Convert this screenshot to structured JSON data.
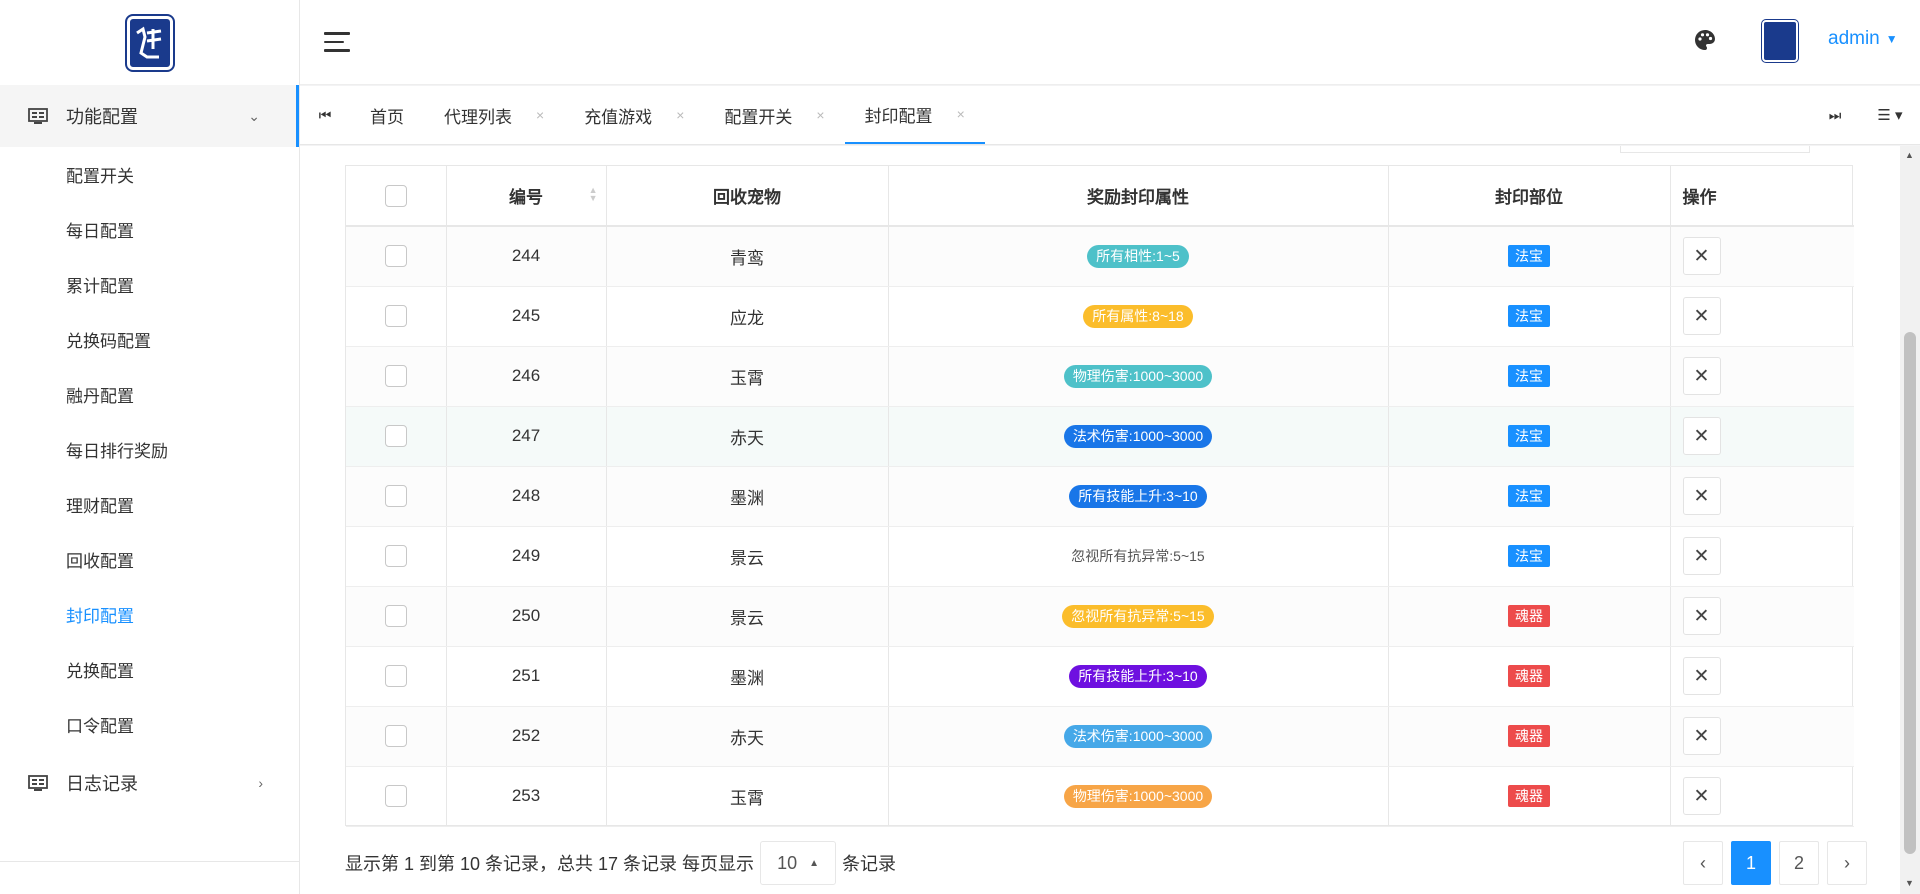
{
  "sidebar": {
    "group1_label": "功能配置",
    "items": [
      "配置开关",
      "每日配置",
      "累计配置",
      "兑换码配置",
      "融丹配置",
      "每日排行奖励",
      "理财配置",
      "回收配置",
      "封印配置",
      "兑换配置",
      "口令配置"
    ],
    "current_item": "封印配置",
    "group2_label": "日志记录"
  },
  "header": {
    "user": "admin"
  },
  "tabs": [
    {
      "label": "首页",
      "closable": false
    },
    {
      "label": "代理列表",
      "closable": true
    },
    {
      "label": "充值游戏",
      "closable": true
    },
    {
      "label": "配置开关",
      "closable": true
    },
    {
      "label": "封印配置",
      "closable": true,
      "active": true
    }
  ],
  "table": {
    "columns": [
      "编号",
      "回收宠物",
      "奖励封印属性",
      "封印部位",
      "操作"
    ],
    "rows": [
      {
        "id": "244",
        "pet": "青鸾",
        "attr": "所有相性:1~5",
        "attr_color": "#4ec1c9",
        "part": "法宝",
        "part_color": "#1890ff"
      },
      {
        "id": "245",
        "pet": "应龙",
        "attr": "所有属性:8~18",
        "attr_color": "#fbbd2b",
        "part": "法宝",
        "part_color": "#1890ff"
      },
      {
        "id": "246",
        "pet": "玉霄",
        "attr": "物理伤害:1000~3000",
        "attr_color": "#4ec1c9",
        "part": "法宝",
        "part_color": "#1890ff"
      },
      {
        "id": "247",
        "pet": "赤天",
        "attr": "法术伤害:1000~3000",
        "attr_color": "#1976e8",
        "part": "法宝",
        "part_color": "#1890ff"
      },
      {
        "id": "248",
        "pet": "墨渊",
        "attr": "所有技能上升:3~10",
        "attr_color": "#1976e8",
        "part": "法宝",
        "part_color": "#1890ff"
      },
      {
        "id": "249",
        "pet": "景云",
        "attr": "忽视所有抗异常:5~15",
        "attr_color": "",
        "part": "法宝",
        "part_color": "#1890ff"
      },
      {
        "id": "250",
        "pet": "景云",
        "attr": "忽视所有抗异常:5~15",
        "attr_color": "#fbbd2b",
        "part": "魂器",
        "part_color": "#ed4b4b"
      },
      {
        "id": "251",
        "pet": "墨渊",
        "attr": "所有技能上升:3~10",
        "attr_color": "#6e10e0",
        "part": "魂器",
        "part_color": "#ed4b4b"
      },
      {
        "id": "252",
        "pet": "赤天",
        "attr": "法术伤害:1000~3000",
        "attr_color": "#46a8e8",
        "part": "魂器",
        "part_color": "#ed4b4b"
      },
      {
        "id": "253",
        "pet": "玉霄",
        "attr": "物理伤害:1000~3000",
        "attr_color": "#f7a547",
        "part": "魂器",
        "part_color": "#ed4b4b"
      }
    ],
    "delete_symbol": "✕"
  },
  "footer": {
    "info_prefix": "显示第 1 到第 10 条记录，总共 17 条记录  每页显示",
    "per_page": "10",
    "info_suffix": "条记录",
    "pages": [
      "‹",
      "1",
      "2",
      "›"
    ],
    "current_page": "1"
  },
  "colors": {
    "accent": "#1890ff"
  }
}
